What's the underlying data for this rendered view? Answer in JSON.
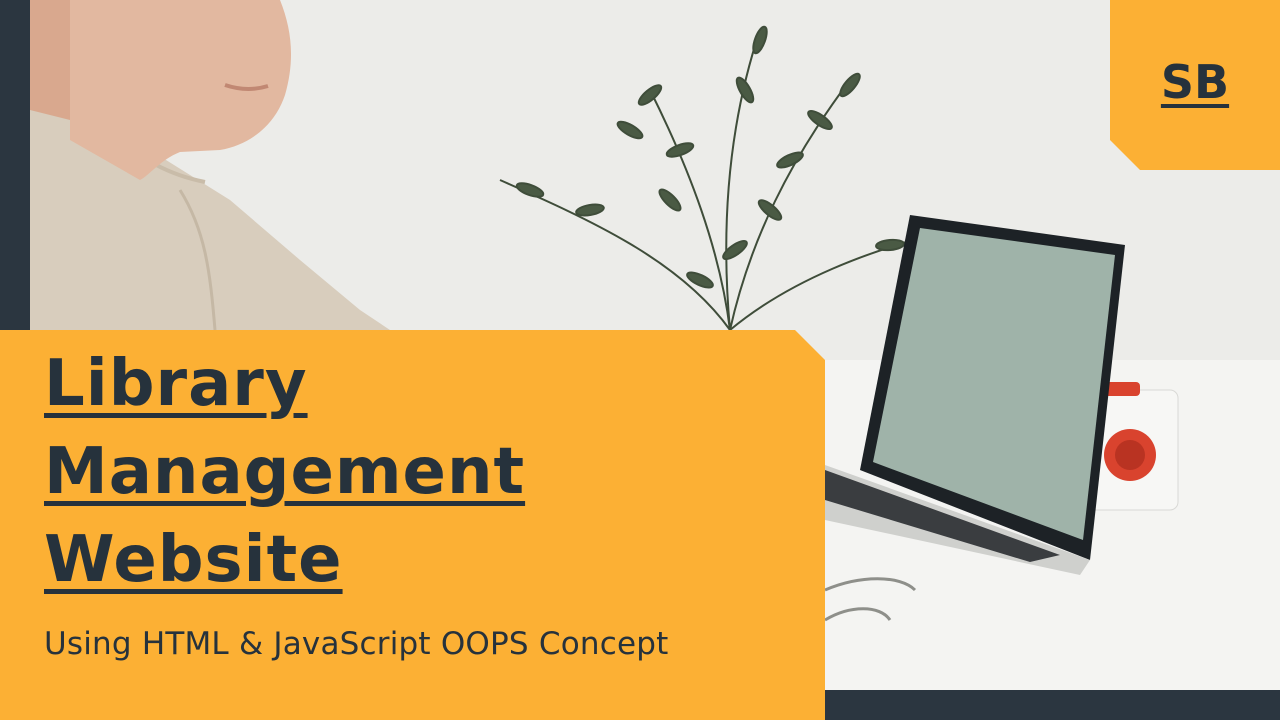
{
  "badge": {
    "text": "SB"
  },
  "title": {
    "line1": "Library",
    "line2": "Management",
    "line3": "Website"
  },
  "subtitle": "Using HTML & JavaScript OOPS Concept",
  "colors": {
    "accent": "#fcb034",
    "dark": "#2b3640",
    "text": "#26323c"
  },
  "photo": {
    "description": "person-laptop-plant-photo"
  }
}
